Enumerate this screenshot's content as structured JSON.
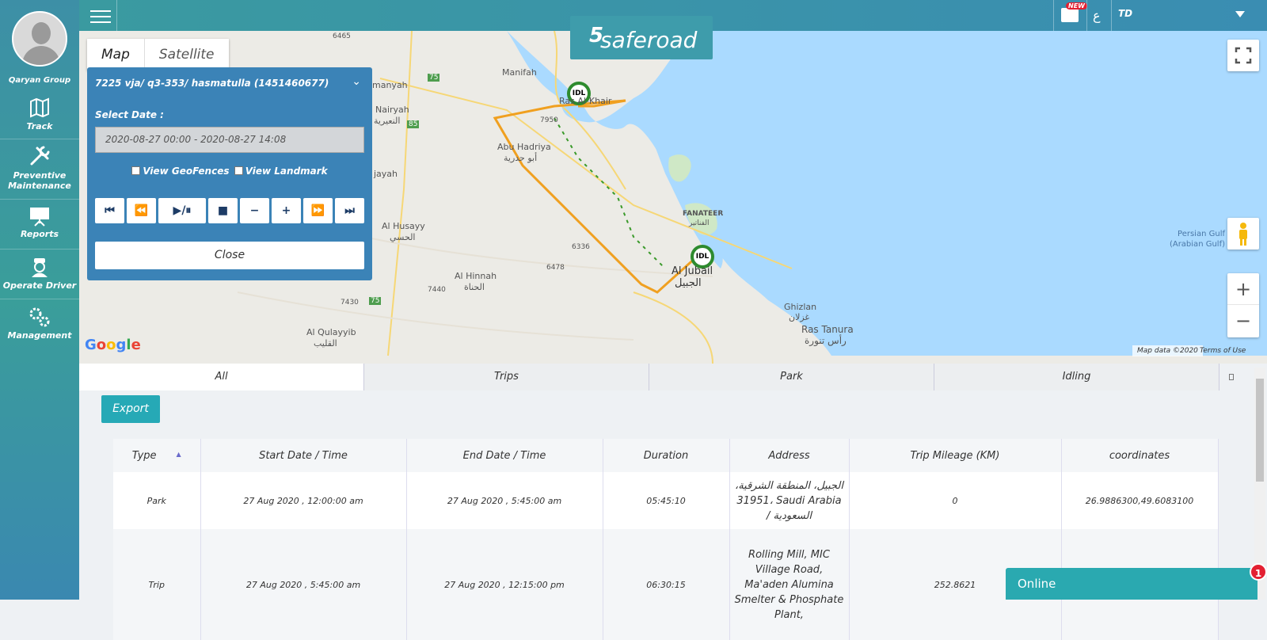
{
  "sidebar": {
    "company": "Qaryan Group",
    "items": [
      {
        "label": "Track",
        "icon": "map-track-icon"
      },
      {
        "label": "Preventive Maintenance",
        "icon": "tools-icon"
      },
      {
        "label": "Reports",
        "icon": "presentation-icon"
      },
      {
        "label": "Operate Driver",
        "icon": "driver-icon"
      },
      {
        "label": "Management",
        "icon": "gears-icon"
      }
    ]
  },
  "header": {
    "logo": "saferoad",
    "new_badge": "NEW",
    "lang_toggle": "ع",
    "user": "TD"
  },
  "map": {
    "tabs": [
      "Map",
      "Satellite"
    ],
    "attribution": "Map data ©2020",
    "terms": "Terms of Use",
    "places": {
      "manifah": "Manifah",
      "ras_khair": "Ras Al-Khair",
      "manyah": "manyah",
      "nairyah": "Nairyah",
      "nairyah_ar": "النعيرية",
      "abu_hadriya": "Abu Hadriya",
      "abu_hadriya_ar": "أبو حدرية",
      "jayah": "jayah",
      "al_husayy": "Al Husayy",
      "al_husayy_ar": "الحسي",
      "al_hinnah": "Al Hinnah",
      "al_hinnah_ar": "الحناة",
      "fanateer": "FANATEER",
      "fanateer_ar": "الفناتير",
      "al_jubail": "Al Jubail",
      "al_jubail_ar": "الجبيل",
      "ghizlan": "Ghizlan",
      "ghizlan_ar": "غزلان",
      "ras_tanura": "Ras Tanura",
      "ras_tanura_ar": "رأس تنورة",
      "al_qulayyib": "Al Qulayyib",
      "al_qulayyib_ar": "القليب",
      "persian_gulf": "Persian Gulf (Arabian Gulf)",
      "road_6465": "6465",
      "road_75a": "75",
      "road_75b": "75",
      "road_85": "85",
      "road_7950": "7950",
      "road_6336": "6336",
      "road_6478": "6478",
      "road_7440": "7440",
      "road_7430": "7430"
    },
    "markers": [
      "IDL",
      "IDL"
    ]
  },
  "panel": {
    "title": "7225 vja/ q3-353/ hasmatulla (1451460677)",
    "select_date_label": "Select Date :",
    "date_range": "2020-08-27 00:00 - 2020-08-27 14:08",
    "view_geofences": "View GeoFences",
    "view_landmark": "View Landmark",
    "controls": [
      "⏮",
      "⏪",
      "▶/⏸",
      "■",
      "−",
      "+",
      "⏩",
      "⏭"
    ],
    "close": "Close"
  },
  "tabs": [
    "All",
    "Trips",
    "Park",
    "Idling"
  ],
  "export_label": "Export",
  "table": {
    "headers": [
      "Type",
      "Start Date / Time",
      "End Date / Time",
      "Duration",
      "Address",
      "Trip Mileage (KM)",
      "coordinates"
    ],
    "rows": [
      {
        "type": "Park",
        "start": "27 Aug 2020 , 12:00:00 am",
        "end": "27 Aug 2020 , 5:45:00 am",
        "duration": "05:45:10",
        "address": "الجبيل، المنطقة الشرقية، 31951، Saudi Arabia / السعودية",
        "mileage": "0",
        "coords": "26.9886300,49.6083100"
      },
      {
        "type": "Trip",
        "start": "27 Aug 2020 , 5:45:00 am",
        "end": "27 Aug 2020 , 12:15:00 pm",
        "duration": "06:30:15",
        "address": "Rolling Mill, MIC Village Road, Ma'aden Alumina Smelter & Phosphate Plant,",
        "mileage": "252.8621",
        "coords": ""
      }
    ]
  },
  "chat": {
    "label": "Online",
    "badge": "1"
  }
}
